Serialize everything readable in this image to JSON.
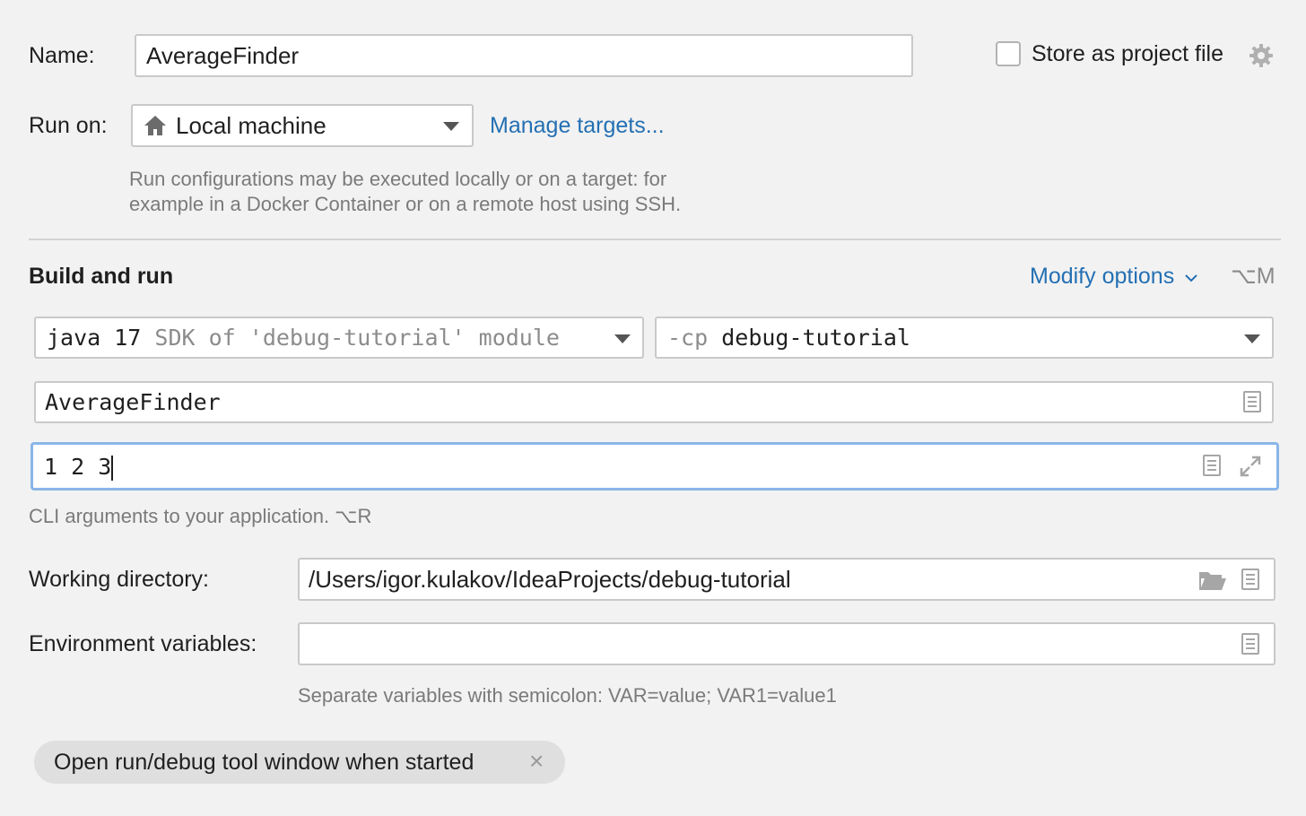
{
  "name_row": {
    "label": "Name:",
    "value": "AverageFinder",
    "store_as_project_file_label": "Store as project file",
    "store_as_project_file_checked": false
  },
  "run_on_row": {
    "label": "Run on:",
    "target_value": "Local machine",
    "manage_targets_link": "Manage targets...",
    "hint_line1": "Run configurations may be executed locally or on a target: for",
    "hint_line2": "example in a Docker Container or on a remote host using SSH."
  },
  "build_and_run": {
    "title": "Build and run",
    "modify_options_label": "Modify options",
    "modify_options_shortcut": "⌥M",
    "jdk": {
      "value": "java 17",
      "detail": "SDK of 'debug-tutorial' module"
    },
    "classpath": {
      "prefix": "-cp",
      "value": "debug-tutorial"
    },
    "main_class_value": "AverageFinder",
    "program_arguments_value": "1 2 3",
    "program_arguments_hint": "CLI arguments to your application. ⌥R"
  },
  "working_directory": {
    "label": "Working directory:",
    "value": "/Users/igor.kulakov/IdeaProjects/debug-tutorial"
  },
  "environment_variables": {
    "label": "Environment variables:",
    "value": "",
    "hint": "Separate variables with semicolon: VAR=value; VAR1=value1"
  },
  "option_chips": [
    {
      "label": "Open run/debug tool window when started",
      "remove_glyph": "×"
    }
  ],
  "icons": {
    "gear": "gear-icon",
    "home": "home-icon",
    "dropdown": "chevron-down-icon",
    "document": "document-icon",
    "expand": "expand-icon",
    "folder": "folder-icon",
    "close": "close-icon"
  },
  "colors": {
    "background": "#f2f2f2",
    "link": "#2470b3",
    "focus_border": "#8ab6e8",
    "chip_background": "#dfdfdf"
  }
}
